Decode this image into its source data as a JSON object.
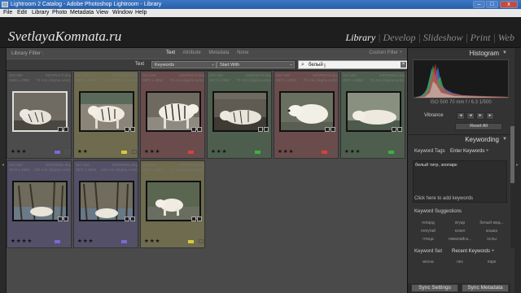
{
  "window": {
    "title": "Lightroom 2 Catalog - Adobe Photoshop Lightroom - Library"
  },
  "menu": [
    "File",
    "Edit",
    "Library",
    "Photo",
    "Metadata",
    "View",
    "Window",
    "Help"
  ],
  "identity_plate": "SvetlayaKomnata.ru",
  "modules": [
    {
      "label": "Library",
      "active": true
    },
    {
      "label": "Develop",
      "active": false
    },
    {
      "label": "Slideshow",
      "active": false
    },
    {
      "label": "Print",
      "active": false
    },
    {
      "label": "Web",
      "active": false
    }
  ],
  "filter": {
    "title": "Library Filter :",
    "tabs": [
      {
        "label": "Text",
        "active": true
      },
      {
        "label": "Attribute",
        "active": false
      },
      {
        "label": "Metadata",
        "active": false
      },
      {
        "label": "None",
        "active": false
      }
    ],
    "custom": "Custom Filter ÷",
    "rule_label": "Text",
    "field": "Keywords",
    "operator": "Start With",
    "search_value": "белый"
  },
  "grid": {
    "cells": [
      {
        "iso": "ISO 500",
        "size": "2592 x 2592",
        "name": "IMGP6472.dng",
        "lens": "70 mm (Sigma Lens)",
        "stars": "★★★",
        "label_color": "#7a6ad0",
        "bg": "#4c4c4c",
        "selected": true,
        "image": "tiger-sleep"
      },
      {
        "iso": "ISO 640",
        "size": "3872 x 2592",
        "name": "IMGP6473.dng",
        "lens": "70 mm (Sigma Lens)",
        "stars": "★★",
        "label_color": "#d8c840",
        "bg": "#6e6b4e",
        "selected": false,
        "image": "tiger-walk"
      },
      {
        "iso": "ISO 640",
        "size": "3872 x 2592",
        "name": "IMGP6474.dng",
        "lens": "70 mm (Sigma Lens)",
        "stars": "★★★",
        "label_color": "#d84040",
        "bg": "#6a4c4c",
        "selected": false,
        "image": "tiger-walk2"
      },
      {
        "iso": "ISO 400",
        "size": "3872 x 2592",
        "name": "IMGP6475.dng",
        "lens": "70 mm (Sigma Lens)",
        "stars": "★★★",
        "label_color": "#40b040",
        "bg": "#4e5e4e",
        "selected": false,
        "image": "tiger-lie"
      },
      {
        "iso": "ISO 500",
        "size": "3872 x 2592",
        "name": "IMGP6578.dng",
        "lens": "70 mm (Sigma Lens)",
        "stars": "★★★",
        "label_color": "#d84040",
        "bg": "#6a4c4c",
        "selected": false,
        "image": "bear-head"
      },
      {
        "iso": "ISO 500",
        "size": "3872 x 2592",
        "name": "IMGP6580.dng",
        "lens": "70 mm (Sigma Lens)",
        "stars": "★★★",
        "label_color": "#40b040",
        "bg": "#4e5e4e",
        "selected": false,
        "image": "bear-lie"
      },
      {
        "iso": "ISO 800",
        "size": "3872 x 2592",
        "name": "IMGP6581.dng",
        "lens": "100 mm (Sigma Lens)",
        "stars": "★★★★",
        "label_color": "#7a6ad0",
        "bg": "#545068",
        "selected": false,
        "image": "bear-water"
      },
      {
        "iso": "ISO 500",
        "size": "3872 x 2592",
        "name": "IMGP6582.dng",
        "lens": "100 mm (Sigma Lens)",
        "stars": "★★★",
        "label_color": "#7a6ad0",
        "bg": "#545068",
        "selected": false,
        "image": "bear-water2"
      },
      {
        "iso": "ISO 640",
        "size": "3872 x 2592",
        "name": "IMGP6583.dng",
        "lens": "70 mm (Sigma Lens)",
        "stars": "★★★",
        "label_color": "#d8c840",
        "bg": "#6e6b4e",
        "selected": false,
        "image": "bear-walk"
      }
    ]
  },
  "panel": {
    "histogram_title": "Histogram",
    "histogram_info": "ISO 500   70 mm   f / 6.3   1/500",
    "vibrance_label": "Vibrance",
    "reset_all": "Reset All",
    "keywording_title": "Keywording",
    "keyword_tags_label": "Keyword Tags",
    "keyword_tags_mode": "Enter Keywords ÷",
    "keywords_text": "белый тигр, зоопарк",
    "add_keywords_hint": "Click here to add keywords",
    "suggestions_title": "Keyword Suggestions",
    "suggestions": [
      "гепард",
      "ягуар",
      "белый мед...",
      "попугай",
      "козел",
      "кошка",
      "птица",
      "гималайск...",
      "ослы"
    ],
    "keyword_set_label": "Keyword Set",
    "keyword_set_value": "Recent Keywords ÷",
    "keyword_set_items": [
      "весна",
      "лес",
      "парк"
    ],
    "sync_settings": "Sync Settings",
    "sync_metadata": "Sync Metadata"
  }
}
